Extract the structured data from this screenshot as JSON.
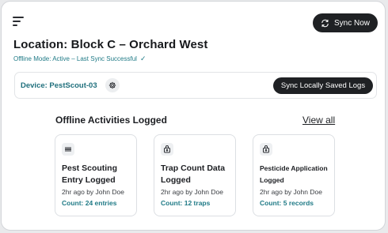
{
  "header": {
    "menu_icon": "menu-icon",
    "sync_now_label": "Sync Now",
    "sync_icon": "sync-icon"
  },
  "location": {
    "title": "Location: Block C – Orchard West",
    "status": "Offline Mode: Active – Last Sync Successful",
    "status_icon": "check-icon"
  },
  "device": {
    "label": "Device: PestScout-03",
    "gear_icon": "gear-icon",
    "sync_logs_label": "Sync Locally Saved Logs"
  },
  "activities": {
    "title": "Offline Activities Logged",
    "view_all_label": "View all",
    "items": [
      {
        "icon": "scouting-icon",
        "title": "Pest Scouting Entry Logged",
        "meta": "2hr ago by John Doe",
        "count": "Count: 24 entries"
      },
      {
        "icon": "trap-icon",
        "title": "Trap Count Data Logged",
        "meta": "2hr ago by John Doe",
        "count": "Count: 12 traps"
      },
      {
        "icon": "pesticide-icon",
        "title": "Pesticide Application Logged",
        "meta": "2hr ago by John Doe",
        "count": "Count: 5 records"
      }
    ]
  },
  "colors": {
    "accent": "#1f7a86",
    "dark_button": "#1f2124"
  }
}
